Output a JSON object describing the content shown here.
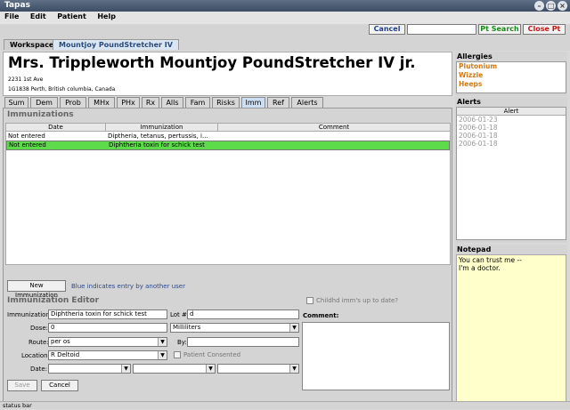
{
  "window": {
    "title": "Tapas"
  },
  "menu": [
    "File",
    "Edit",
    "Patient",
    "Help"
  ],
  "doc_tabs": [
    "Workspace",
    "Mountjoy PoundStretcher IV"
  ],
  "toolbar": {
    "cancel": "Cancel",
    "search_value": "",
    "pt_search": "Pt Search",
    "close_pt": "Close Pt"
  },
  "patient": {
    "name": "Mrs. Trippleworth Mountjoy PoundStretcher IV jr.",
    "address_line1": "2231 1st Ave",
    "address_line2": "1G1838 Perth, British columbia, Canada"
  },
  "chart_tabs": [
    "Sum",
    "Dem",
    "Prob",
    "MHx",
    "PHx",
    "Rx",
    "Alls",
    "Fam",
    "Risks",
    "Imm",
    "Ref",
    "Alerts"
  ],
  "immunizations": {
    "title": "Immunizations",
    "columns": [
      "Date",
      "Immunization",
      "Comment"
    ],
    "rows": [
      {
        "date": "Not entered",
        "immunization": "Diptheria, tetanus, pertussis, i...",
        "comment": ""
      },
      {
        "date": "Not entered",
        "immunization": "Diphtheria toxin for schick test",
        "comment": ""
      }
    ]
  },
  "new_immunization_button": "New Immunization",
  "blue_note": "Blue indicates entry by another user",
  "editor": {
    "title": "Immunization Editor",
    "childhood_check": "Childhd imm's up to date?",
    "immunization_label": "Immunization:",
    "immunization_value": "Diphtheria toxin for schick test",
    "lot_label": "Lot #:",
    "lot_value": "d",
    "comment_label": "Comment:",
    "dose_label": "Dose:",
    "dose_value": "0",
    "unit_value": "Milliliters",
    "route_label": "Route:",
    "route_value": "per os",
    "by_label": "By:",
    "location_label": "Location:",
    "location_value": "R Deltoid",
    "consented_label": "Patient Consented",
    "date_label": "Date:",
    "save": "Save",
    "cancel": "Cancel"
  },
  "allergies": {
    "title": "Allergies",
    "items": [
      "Plutonium",
      "Wizzle",
      "Heeps"
    ]
  },
  "alerts": {
    "title": "Alerts",
    "column": "Alert",
    "items": [
      "2006-01-23",
      "2006-01-18",
      "2006-01-18",
      "2006-01-18"
    ]
  },
  "notepad": {
    "title": "Notepad",
    "line1": "You can trust me --",
    "line2": "I'm a doctor."
  },
  "status": "status bar",
  "colors": {
    "selected_row": "#5ddb4a",
    "allergy_text": "#d17a14",
    "notepad_bg": "#ffffcc",
    "title_bar": "#4a5a72"
  }
}
